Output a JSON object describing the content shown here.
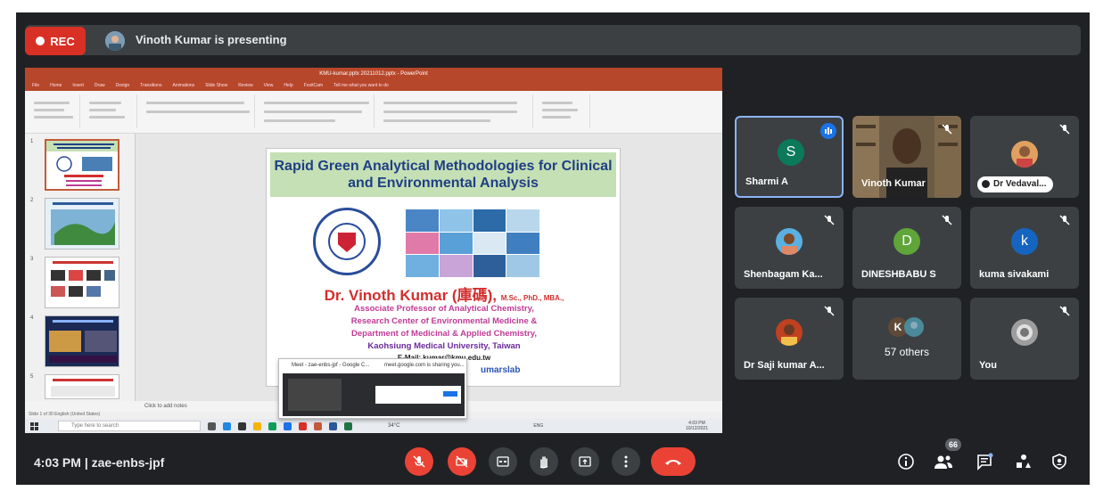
{
  "top_bar": {
    "rec_label": "REC",
    "presenter_text": "Vinoth Kumar is presenting"
  },
  "shared_screen": {
    "ppt_window_title": "KMU-kumar.pptx 20211012.pptx - PowerPoint",
    "ppt_tabs": [
      "File",
      "Home",
      "Insert",
      "Draw",
      "Design",
      "Transitions",
      "Animations",
      "Slide Show",
      "Review",
      "View",
      "Help",
      "FoxitCam",
      "Tell me what you want to do"
    ],
    "thumbnail_numbers": [
      "1",
      "2",
      "3",
      "4",
      "5"
    ],
    "slide": {
      "title": "Rapid Green Analytical Methodologies for Clinical and  Environmental Analysis",
      "name": "Dr. Vinoth Kumar (庫碼),",
      "name_suffix": "M.Sc., PhD., MBA.,",
      "lines": [
        "Associate Professor of Analytical Chemistry,",
        "Research Center of Environmental Medicine &",
        "Department of Medicinal & Applied Chemistry,",
        "Kaohsiung Medical University, Taiwan",
        "E-Mail: kumar@kmu.edu.tw"
      ],
      "line_colors": [
        "#c03a95",
        "#c03a95",
        "#c03a95",
        "#6a2a9a",
        "#222222"
      ],
      "partial_link": "umarslab"
    },
    "notes_placeholder": "Click to add notes",
    "status_text": "Slide 1 of 30   English (United States)",
    "taskbar": {
      "search_placeholder": "Type here to search",
      "weather": "34°C",
      "clock_time": "4:03 PM",
      "clock_date": "10/12/2021",
      "lang": "ENG"
    },
    "popup_tabs": [
      "Meet - zae-enbs-jpf - Google C...",
      "meet.google.com is sharing you..."
    ]
  },
  "participants": [
    {
      "name": "Sharmi A",
      "initial": "S",
      "avatar_color": "#0b7a5a",
      "speaking": true,
      "muted": false
    },
    {
      "name": "Vinoth Kumar",
      "video": true,
      "muted": true
    },
    {
      "name": "Dr Vedaval...",
      "photo": true,
      "muted": true
    },
    {
      "name": "Shenbagam Ka...",
      "photo": true,
      "muted": true
    },
    {
      "name": "DINESHBABU S",
      "initial": "D",
      "avatar_color": "#5fa539",
      "muted": true
    },
    {
      "name": "kuma sivakami",
      "initial": "k",
      "avatar_color": "#1565c0",
      "muted": true
    },
    {
      "name": "Dr Saji kumar A...",
      "photo": true,
      "muted": true
    },
    {
      "name": "57 others",
      "others_initial": "K"
    },
    {
      "name": "You",
      "photo": true,
      "muted": true
    }
  ],
  "bottom_bar": {
    "time": "4:03 PM",
    "separator": "|",
    "meeting_code": "zae-enbs-jpf",
    "people_count": "66",
    "controls": [
      "mic-off-icon",
      "camera-off-icon",
      "captions-icon",
      "raise-hand-icon",
      "present-icon",
      "more-options-icon",
      "end-call-icon"
    ],
    "right_icons": [
      "info-icon",
      "people-icon",
      "chat-icon",
      "activities-icon",
      "host-controls-icon"
    ]
  },
  "colors": {
    "background": "#202124",
    "tile": "#3c4043",
    "accent_red": "#ea4335",
    "speaking_border": "#8ab4f8"
  }
}
